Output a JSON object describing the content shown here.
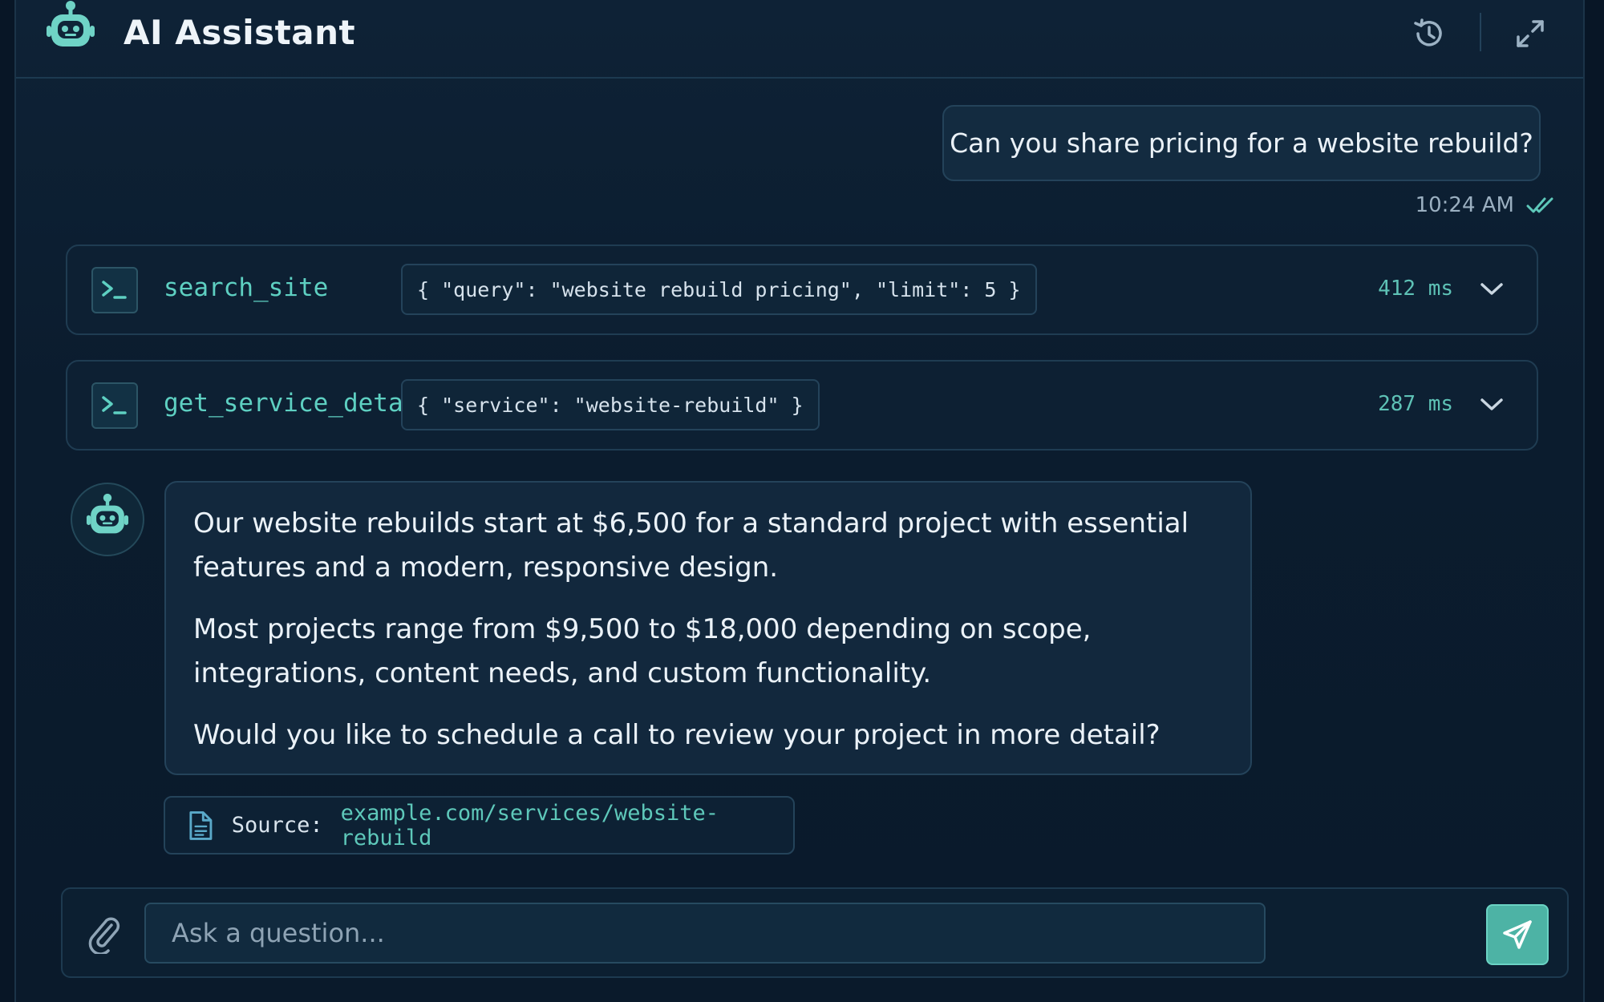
{
  "header": {
    "title": "AI Assistant",
    "logo_icon": "robot-icon",
    "history_icon": "history-icon",
    "expand_icon": "expand-icon"
  },
  "user_message": {
    "text": "Can you share pricing for a website rebuild?",
    "time": "10:24 AM",
    "status_icon": "double-check-icon"
  },
  "tool_calls": [
    {
      "name": "search_site",
      "args": "{ \"query\": \"website rebuild pricing\", \"limit\": 5 }",
      "duration": "412 ms",
      "icon": "terminal-icon"
    },
    {
      "name": "get_service_details",
      "args": "{ \"service\": \"website-rebuild\" }",
      "duration": "287 ms",
      "icon": "terminal-icon"
    }
  ],
  "assistant_message": {
    "paragraphs": [
      "Our website rebuilds start at $6,500 for a standard project with essential features and a modern, responsive design.",
      "Most projects range from $9,500 to $18,000 depending on scope, integrations, content needs, and custom functionality.",
      "Would you like to schedule a call to review your project in more detail?"
    ],
    "avatar_icon": "robot-icon"
  },
  "source": {
    "label": "Source:",
    "link": "example.com/services/website-rebuild",
    "icon": "document-icon"
  },
  "composer": {
    "placeholder": "Ask a question...",
    "attach_icon": "paperclip-icon",
    "send_icon": "send-icon"
  },
  "colors": {
    "background": "#0b1c2e",
    "accent": "#5ed0c2",
    "send_button": "#4db3a5",
    "border": "#24435a"
  }
}
